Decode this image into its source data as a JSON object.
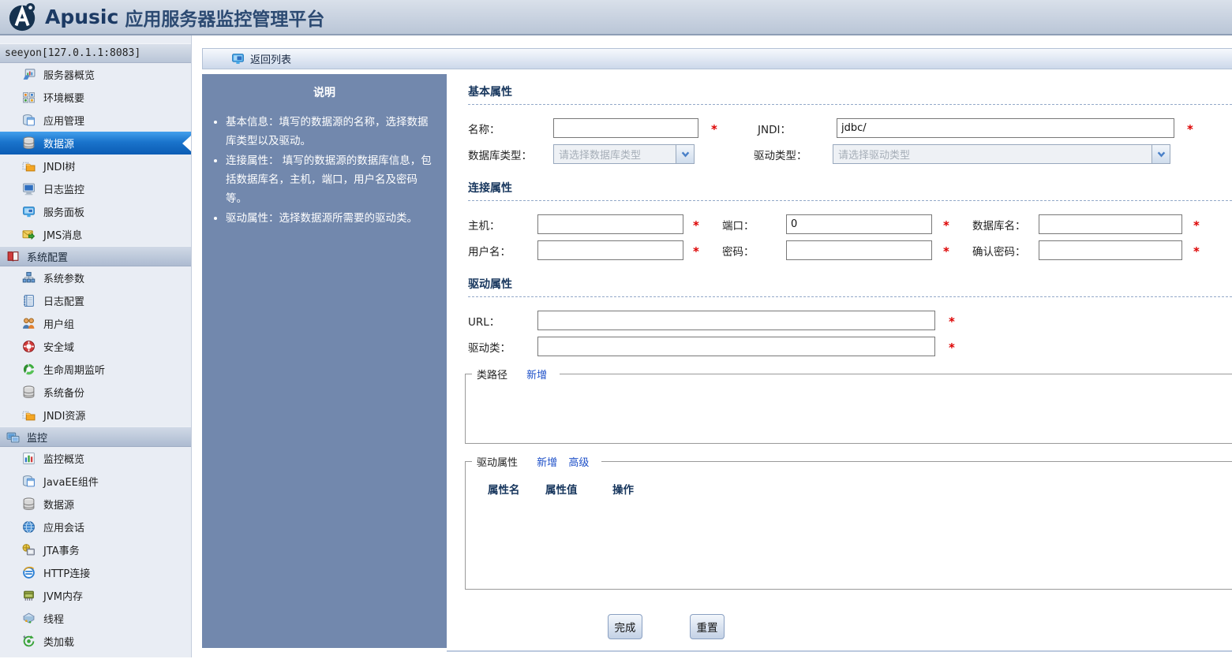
{
  "header": {
    "brand": "Apusic",
    "title": "应用服务器监控管理平台"
  },
  "sidebar": {
    "server": "seeyon[127.0.1.1:8083]",
    "main_items": [
      "服务器概览",
      "环境概要",
      "应用管理",
      "数据源",
      "JNDI树",
      "日志监控",
      "服务面板",
      "JMS消息"
    ],
    "section_system": "系统配置",
    "system_items": [
      "系统参数",
      "日志配置",
      "用户组",
      "安全域",
      "生命周期监听",
      "系统备份",
      "JNDI资源"
    ],
    "section_monitor": "监控",
    "monitor_items": [
      "监控概览",
      "JavaEE组件",
      "数据源",
      "应用会话",
      "JTA事务",
      "HTTP连接",
      "JVM内存",
      "线程",
      "类加载"
    ]
  },
  "toolbar": {
    "back_label": "返回列表"
  },
  "help": {
    "title": "说明",
    "bullets": [
      "基本信息：填写的数据源的名称，选择数据库类型以及驱动。",
      "连接属性： 填写的数据源的数据库信息，包括数据库名，主机，端口，用户名及密码等。",
      "驱动属性：选择数据源所需要的驱动类。"
    ]
  },
  "form": {
    "required": "*",
    "sections": {
      "basic": "基本属性",
      "connection": "连接属性",
      "driver": "驱动属性"
    },
    "fields": {
      "name": {
        "label": "名称：",
        "value": ""
      },
      "jndi": {
        "label": "JNDI：",
        "value": "jdbc/"
      },
      "db_type": {
        "label": "数据库类型：",
        "placeholder": "请选择数据库类型"
      },
      "driver_type": {
        "label": "驱动类型：",
        "placeholder": "请选择驱动类型"
      },
      "host": {
        "label": "主机：",
        "value": ""
      },
      "port": {
        "label": "端口：",
        "value": "0"
      },
      "db_name": {
        "label": "数据库名：",
        "value": ""
      },
      "username": {
        "label": "用户名：",
        "value": ""
      },
      "password": {
        "label": "密码：",
        "value": ""
      },
      "confirm_password": {
        "label": "确认密码：",
        "value": ""
      },
      "url": {
        "label": "URL：",
        "value": ""
      },
      "driver_class": {
        "label": "驱动类：",
        "value": ""
      }
    },
    "classpath": {
      "legend": "类路径",
      "add": "新增"
    },
    "driver_props": {
      "legend": "驱动属性",
      "add": "新增",
      "advanced": "高级",
      "columns": [
        "属性名",
        "属性值",
        "操作"
      ]
    },
    "buttons": {
      "submit": "完成",
      "reset": "重置"
    }
  },
  "colors": {
    "active_blue": "#1a74cc",
    "panel_blue": "#7288ad",
    "link_blue": "#1e50c8",
    "required_red": "#dd0000"
  }
}
